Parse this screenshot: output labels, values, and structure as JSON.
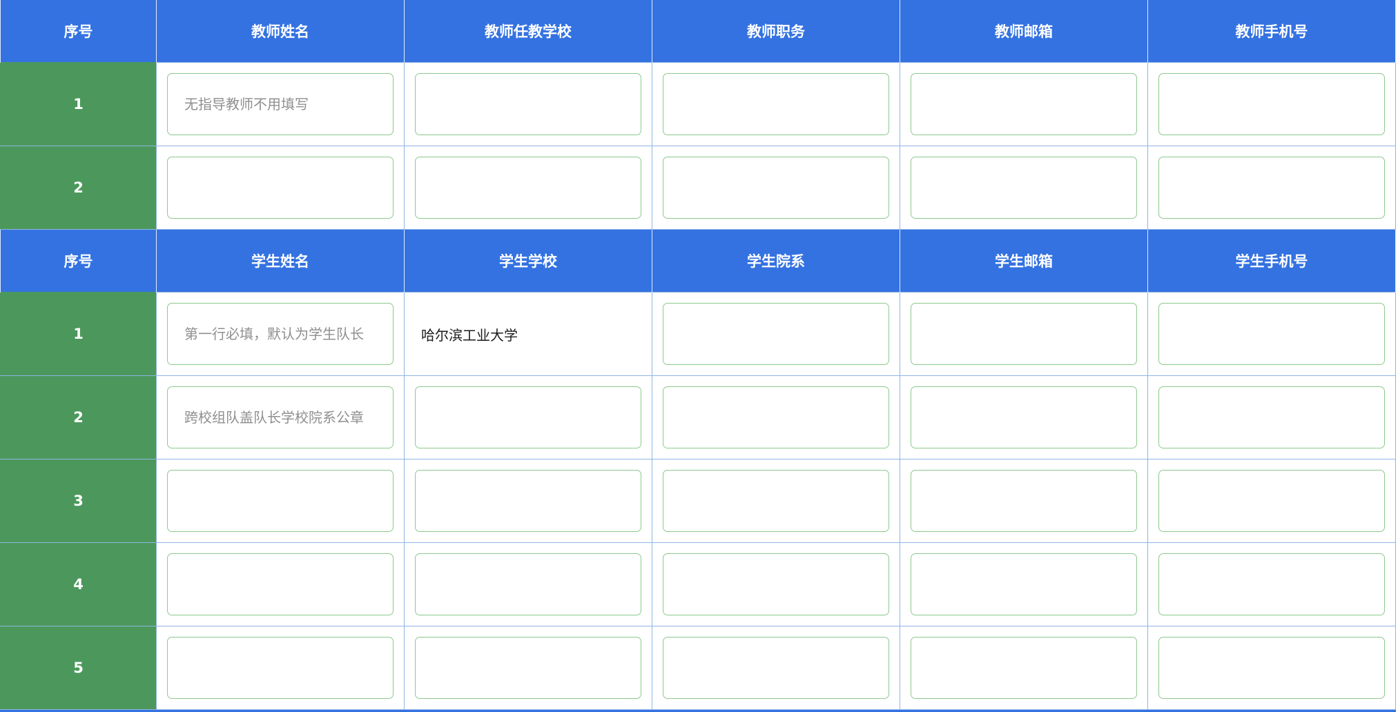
{
  "colors": {
    "header_bg": "#3472e1",
    "index_bg": "#4c985c",
    "field_border": "#8cc98b",
    "cell_border": "#8fb4e4"
  },
  "teacher": {
    "headers": [
      "序号",
      "教师姓名",
      "教师任教学校",
      "教师职务",
      "教师邮箱",
      "教师手机号"
    ],
    "rows": [
      {
        "index": "1",
        "fields": [
          {
            "value": "",
            "placeholder": "无指导教师不用填写"
          },
          {
            "value": "",
            "placeholder": ""
          },
          {
            "value": "",
            "placeholder": ""
          },
          {
            "value": "",
            "placeholder": ""
          },
          {
            "value": "",
            "placeholder": ""
          }
        ]
      },
      {
        "index": "2",
        "fields": [
          {
            "value": "",
            "placeholder": ""
          },
          {
            "value": "",
            "placeholder": ""
          },
          {
            "value": "",
            "placeholder": ""
          },
          {
            "value": "",
            "placeholder": ""
          },
          {
            "value": "",
            "placeholder": ""
          }
        ]
      }
    ]
  },
  "student": {
    "headers": [
      "序号",
      "学生姓名",
      "学生学校",
      "学生院系",
      "学生邮箱",
      "学生手机号"
    ],
    "fixed_school": "哈尔滨工业大学",
    "rows": [
      {
        "index": "1",
        "fields": [
          {
            "value": "",
            "placeholder": "第一行必填，默认为学生队长"
          },
          {
            "value": "",
            "placeholder": ""
          },
          {
            "value": "",
            "placeholder": ""
          },
          {
            "value": "",
            "placeholder": ""
          },
          {
            "value": "",
            "placeholder": ""
          }
        ]
      },
      {
        "index": "2",
        "fields": [
          {
            "value": "",
            "placeholder": "跨校组队盖队长学校院系公章"
          },
          {
            "value": "",
            "placeholder": ""
          },
          {
            "value": "",
            "placeholder": ""
          },
          {
            "value": "",
            "placeholder": ""
          },
          {
            "value": "",
            "placeholder": ""
          }
        ]
      },
      {
        "index": "3",
        "fields": [
          {
            "value": "",
            "placeholder": ""
          },
          {
            "value": "",
            "placeholder": ""
          },
          {
            "value": "",
            "placeholder": ""
          },
          {
            "value": "",
            "placeholder": ""
          },
          {
            "value": "",
            "placeholder": ""
          }
        ]
      },
      {
        "index": "4",
        "fields": [
          {
            "value": "",
            "placeholder": ""
          },
          {
            "value": "",
            "placeholder": ""
          },
          {
            "value": "",
            "placeholder": ""
          },
          {
            "value": "",
            "placeholder": ""
          },
          {
            "value": "",
            "placeholder": ""
          }
        ]
      },
      {
        "index": "5",
        "fields": [
          {
            "value": "",
            "placeholder": ""
          },
          {
            "value": "",
            "placeholder": ""
          },
          {
            "value": "",
            "placeholder": ""
          },
          {
            "value": "",
            "placeholder": ""
          },
          {
            "value": "",
            "placeholder": ""
          }
        ]
      }
    ]
  }
}
